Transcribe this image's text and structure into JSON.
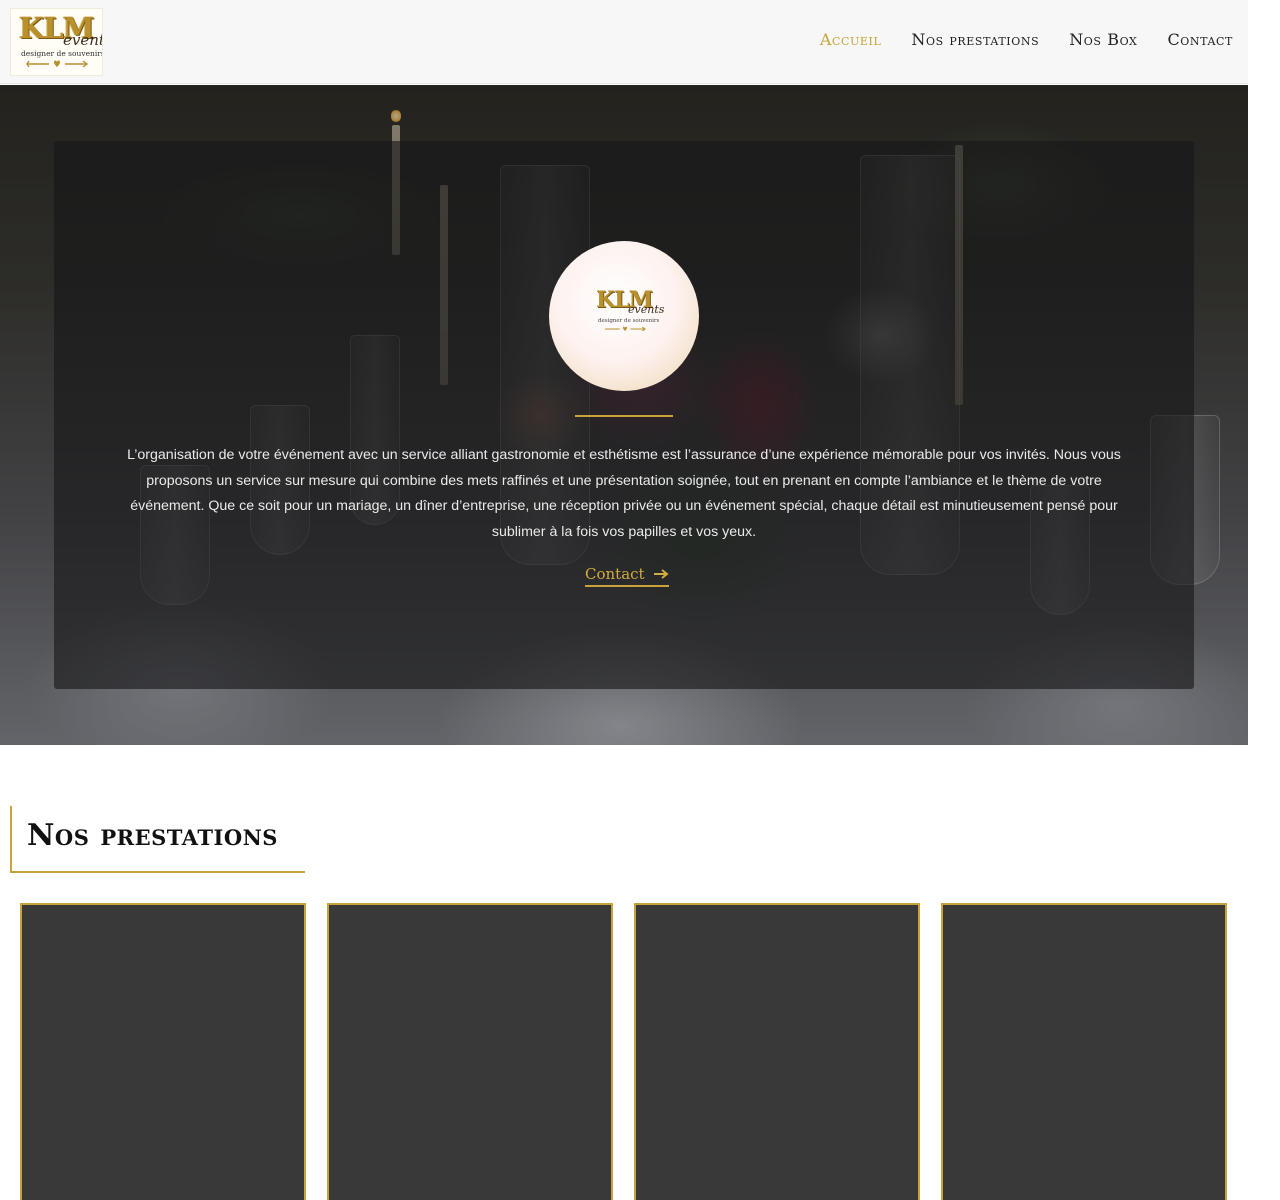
{
  "brand": {
    "logo_main": "KLM",
    "logo_sub": "events",
    "logo_tagline": "designer de souvenirs"
  },
  "nav": {
    "items": [
      {
        "label": "Accueil",
        "active": true
      },
      {
        "label": "Nos prestations",
        "active": false
      },
      {
        "label": "Nos Box",
        "active": false
      },
      {
        "label": "Contact",
        "active": false
      }
    ]
  },
  "hero": {
    "description": "L’organisation de votre événement avec un service alliant gastronomie et esthétisme est l’assurance d’une expérience mémorable pour vos invités. Nous vous proposons un service sur mesure qui combine des mets raffinés et une présentation soignée, tout en prenant en compte l’ambiance et le thème de votre événement. Que ce soit pour un mariage, un dîner d’entreprise, une réception privée ou un événement spécial, chaque détail est minutieusement pensé pour sublimer à la fois vos papilles et vos yeux.",
    "cta_label": "Contact",
    "cta_icon": "arrow-right-icon"
  },
  "prestations": {
    "title": "Nos prestations",
    "cards_count_visible": 4
  },
  "colors": {
    "accent": "#c9a23a",
    "header_bg": "#f7f7f7",
    "card_bg": "#393939",
    "text_dark": "#111111"
  }
}
